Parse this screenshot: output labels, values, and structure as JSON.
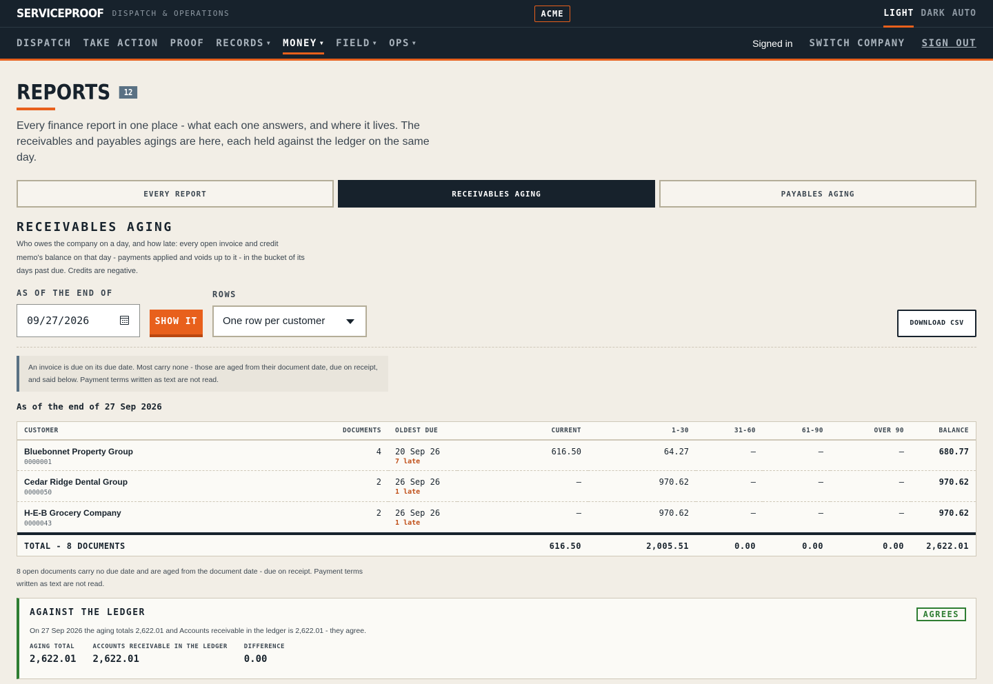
{
  "topbar": {
    "brand": "SERVICEPROOF",
    "brand_sub": "DISPATCH & OPERATIONS",
    "company": "ACME",
    "themes": [
      "LIGHT",
      "DARK",
      "AUTO"
    ],
    "active_theme": "LIGHT"
  },
  "nav": {
    "items": [
      {
        "label": "DISPATCH",
        "caret": ""
      },
      {
        "label": "TAKE ACTION",
        "caret": ""
      },
      {
        "label": "PROOF",
        "caret": ""
      },
      {
        "label": "RECORDS",
        "caret": "▼"
      },
      {
        "label": "MONEY",
        "caret": "▼"
      },
      {
        "label": "FIELD",
        "caret": "▼"
      },
      {
        "label": "OPS",
        "caret": "▼"
      }
    ],
    "active": "MONEY",
    "signed_in": "Signed in",
    "switch_company": "SWITCH COMPANY",
    "sign_out": "SIGN OUT"
  },
  "page": {
    "title": "REPORTS",
    "count": "12",
    "intro": "Every finance report in one place - what each one answers, and where it lives. The receivables and payables agings are here, each held against the ledger on the same day."
  },
  "tabs": [
    "EVERY REPORT",
    "RECEIVABLES AGING",
    "PAYABLES AGING"
  ],
  "active_tab": "RECEIVABLES AGING",
  "section": {
    "title": "RECEIVABLES AGING",
    "desc": "Who owes the company on a day, and how late: every open invoice and credit memo's balance on that day - payments applied and voids up to it - in the bucket of its days past due. Credits are negative."
  },
  "controls": {
    "asof_label": "AS OF THE END OF",
    "date_value": "09/27/2026",
    "show_label": "SHOW IT",
    "rows_label": "ROWS",
    "rows_value": "One row per customer",
    "csv_label": "DOWNLOAD CSV"
  },
  "note": "An invoice is due on its due date. Most carry none - those are aged from their document date, due on receipt, and said below. Payment terms written as text are not read.",
  "asof_heading": "As of the end of 27 Sep 2026",
  "table": {
    "headers": [
      "CUSTOMER",
      "DOCUMENTS",
      "OLDEST DUE",
      "CURRENT",
      "1-30",
      "31-60",
      "61-90",
      "OVER 90",
      "BALANCE"
    ],
    "rows": [
      {
        "name": "Bluebonnet Property Group",
        "id": "0000001",
        "docs": "4",
        "oldest": "20 Sep 26",
        "late": "7 late",
        "current": "616.50",
        "d1_30": "64.27",
        "d31_60": "—",
        "d61_90": "—",
        "over90": "—",
        "balance": "680.77"
      },
      {
        "name": "Cedar Ridge Dental Group",
        "id": "0000050",
        "docs": "2",
        "oldest": "26 Sep 26",
        "late": "1 late",
        "current": "—",
        "d1_30": "970.62",
        "d31_60": "—",
        "d61_90": "—",
        "over90": "—",
        "balance": "970.62"
      },
      {
        "name": "H-E-B Grocery Company",
        "id": "0000043",
        "docs": "2",
        "oldest": "26 Sep 26",
        "late": "1 late",
        "current": "—",
        "d1_30": "970.62",
        "d31_60": "—",
        "d61_90": "—",
        "over90": "—",
        "balance": "970.62"
      }
    ],
    "total": {
      "label": "TOTAL - 8 DOCUMENTS",
      "current": "616.50",
      "d1_30": "2,005.51",
      "d31_60": "0.00",
      "d61_90": "0.00",
      "over90": "0.00",
      "balance": "2,622.01"
    }
  },
  "footnote": "8 open documents carry no due date and are aged from the document date - due on receipt. Payment terms written as text are not read.",
  "ledger": {
    "title": "AGAINST THE LEDGER",
    "status": "AGREES",
    "text": "On 27 Sep 2026 the aging totals 2,622.01 and Accounts receivable in the ledger is 2,622.01 - they agree.",
    "stats": [
      {
        "label": "AGING TOTAL",
        "value": "2,622.01"
      },
      {
        "label": "ACCOUNTS RECEIVABLE IN THE LEDGER",
        "value": "2,622.01"
      },
      {
        "label": "DIFFERENCE",
        "value": "0.00"
      }
    ]
  },
  "colors": {
    "accent": "#e8601c",
    "navy": "#17222c",
    "ok": "#2e7d32",
    "page": "#f2eee6"
  }
}
